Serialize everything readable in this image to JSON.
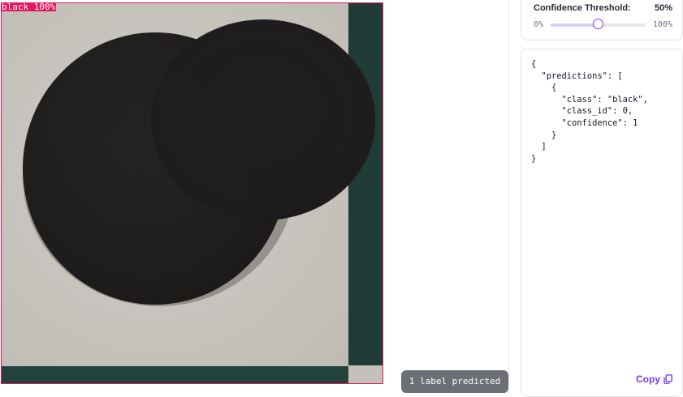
{
  "preview": {
    "detection_label": "black 100%",
    "label_color": "#e8175d",
    "image_description_icon": "black-checker-piece-photo"
  },
  "status_toast": "1 label predicted",
  "settings": {
    "threshold_label": "Confidence Threshold:",
    "threshold_display": "50%",
    "threshold_value": 0.5,
    "slider_min_label": "0%",
    "slider_max_label": "100%",
    "accent_color": "#7c3aed"
  },
  "output": {
    "json_lines": [
      "{",
      "  \"predictions\": [",
      "    {",
      "      \"class\": \"black\",",
      "      \"class_id\": 0,",
      "      \"confidence\": 1",
      "    }",
      "  ]",
      "}"
    ],
    "copy_label": "Copy",
    "copy_icon": "copy-icon"
  }
}
